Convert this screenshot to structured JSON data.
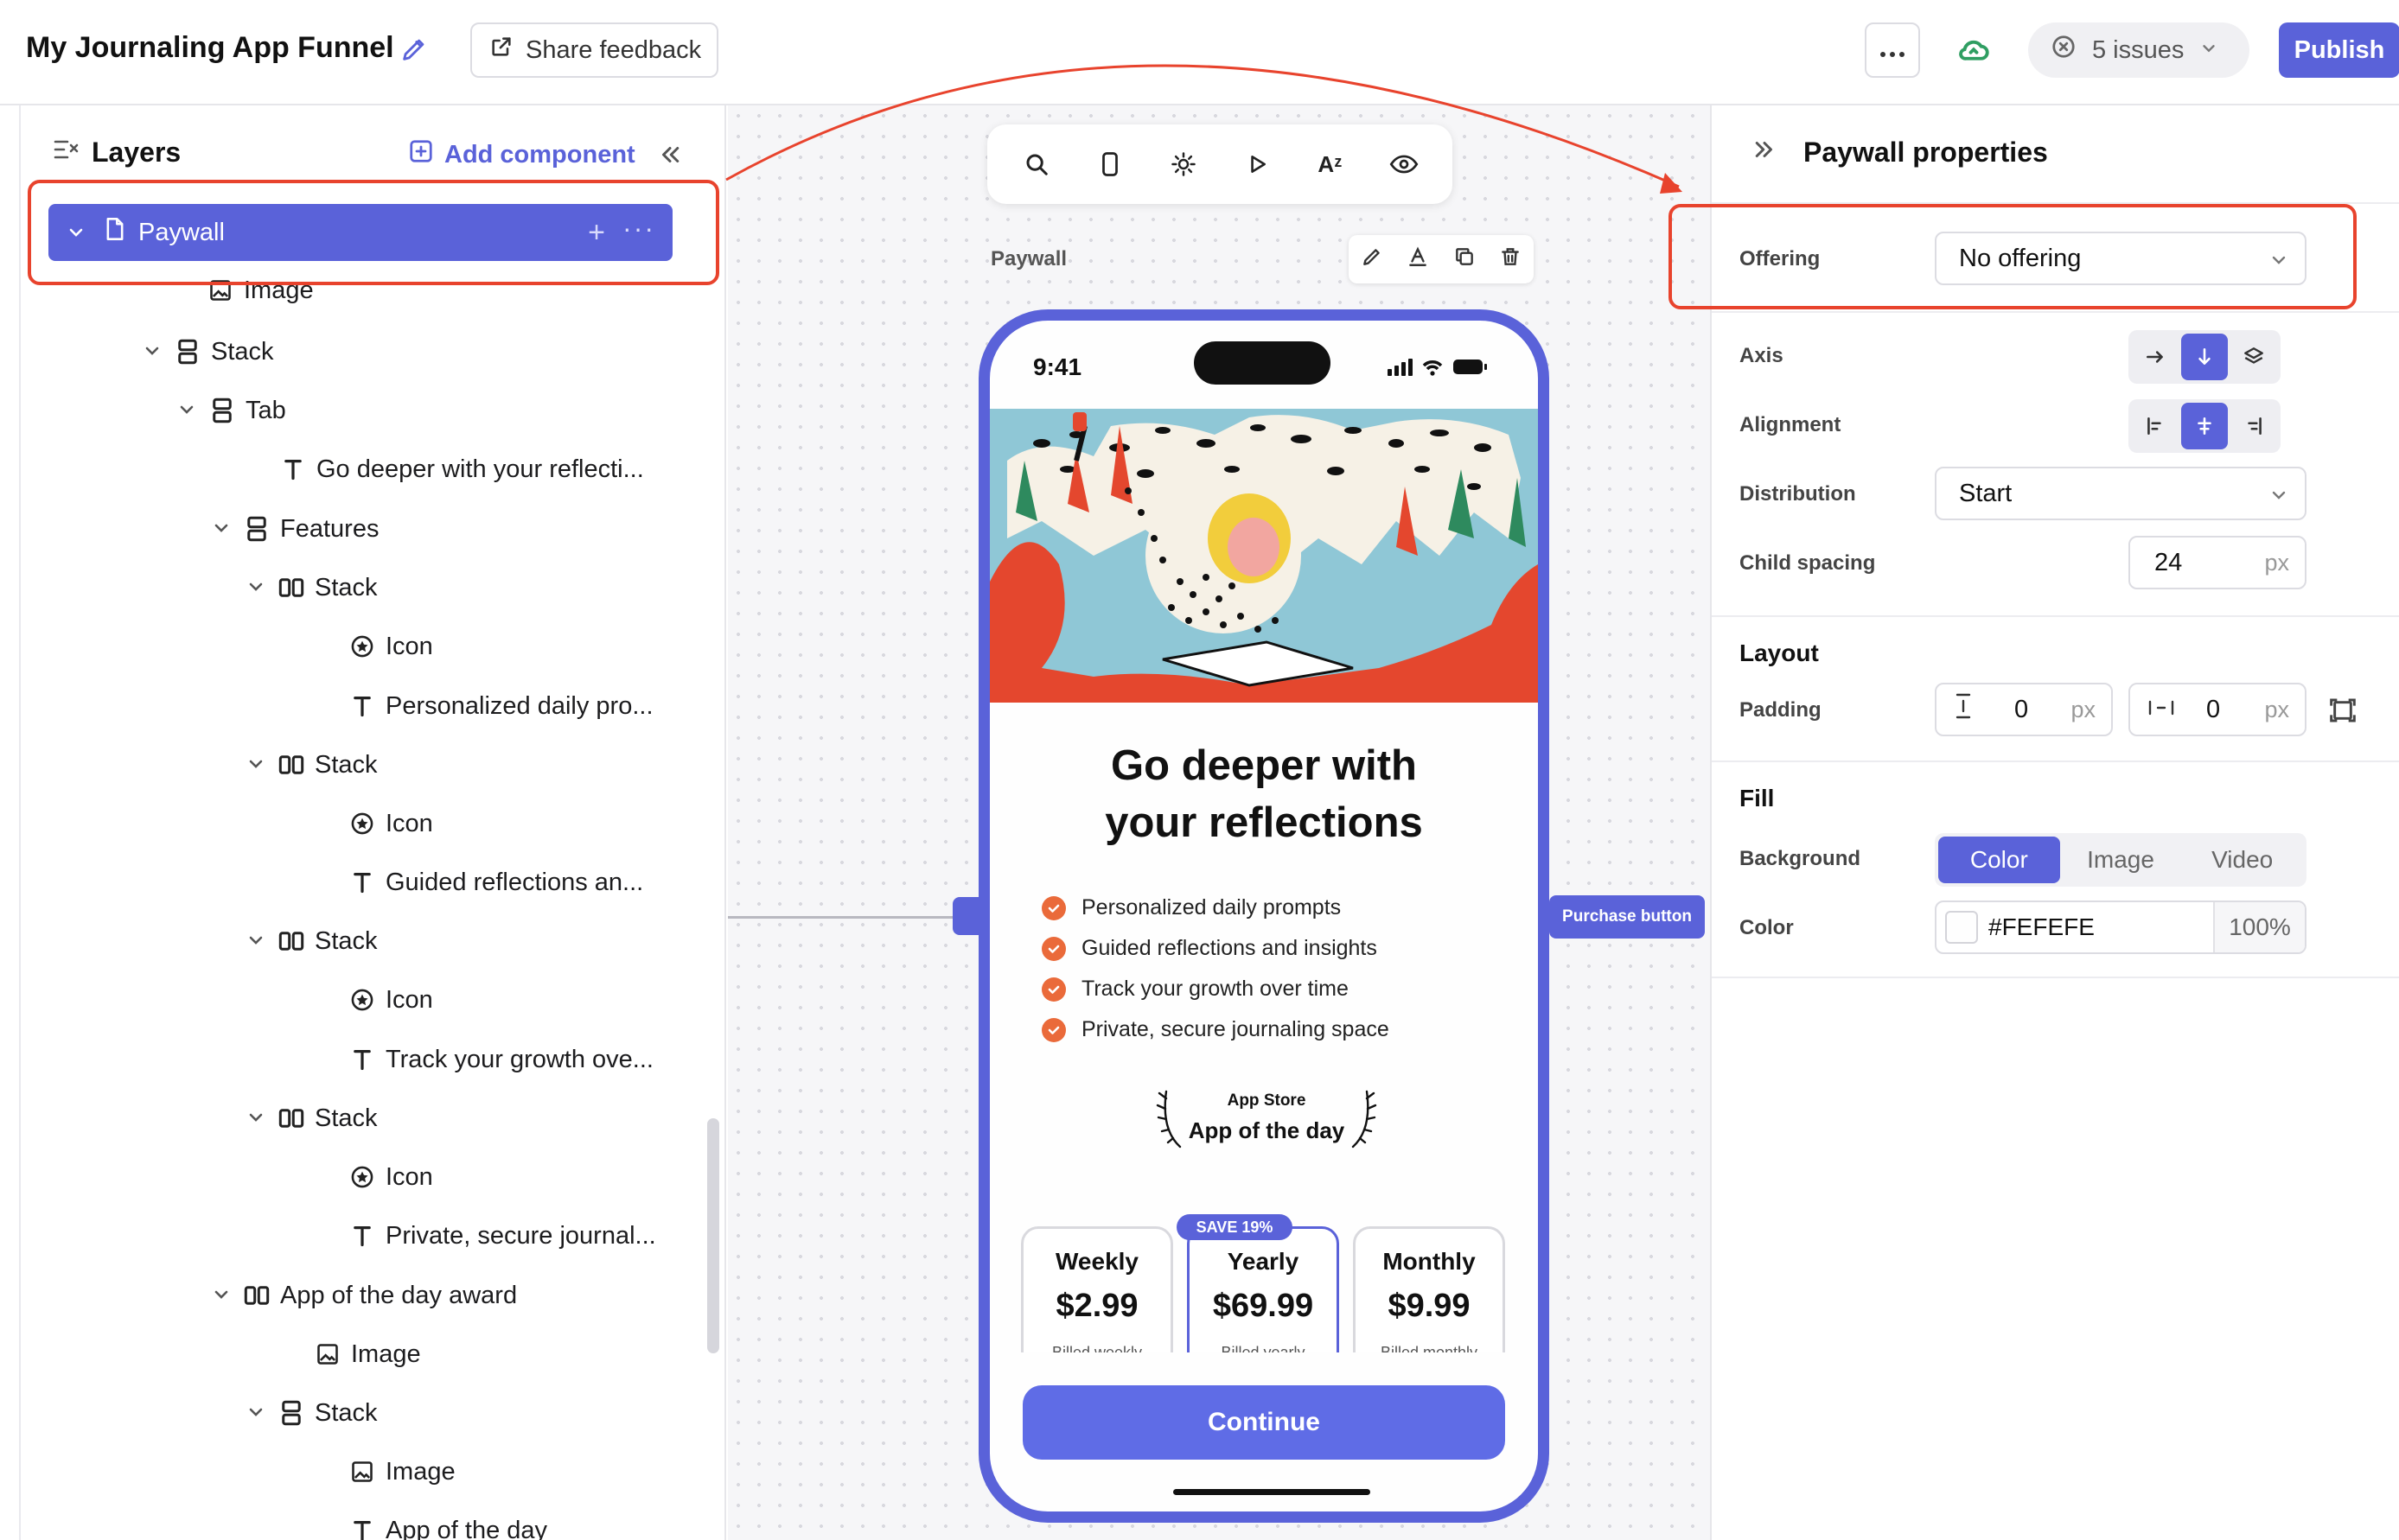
{
  "header": {
    "app_title": "My Journaling App Funnel",
    "share_label": "Share feedback",
    "issues_label": "5 issues",
    "publish_label": "Publish"
  },
  "layers": {
    "title": "Layers",
    "add_component": "Add component",
    "selected": "Paywall",
    "rows": [
      {
        "label": "Image",
        "icon": "image-icon"
      },
      {
        "label": "Stack",
        "icon": "vstack-icon"
      },
      {
        "label": "Tab",
        "icon": "vstack-icon"
      },
      {
        "label": "Go deeper with your reflecti...",
        "icon": "text-icon"
      },
      {
        "label": "Features",
        "icon": "vstack-icon"
      },
      {
        "label": "Stack",
        "icon": "hstack-icon"
      },
      {
        "label": "Icon",
        "icon": "star-icon"
      },
      {
        "label": "Personalized daily pro...",
        "icon": "text-icon"
      },
      {
        "label": "Stack",
        "icon": "hstack-icon"
      },
      {
        "label": "Icon",
        "icon": "star-icon"
      },
      {
        "label": "Guided reflections an...",
        "icon": "text-icon"
      },
      {
        "label": "Stack",
        "icon": "hstack-icon"
      },
      {
        "label": "Icon",
        "icon": "star-icon"
      },
      {
        "label": "Track your growth ove...",
        "icon": "text-icon"
      },
      {
        "label": "Stack",
        "icon": "hstack-icon"
      },
      {
        "label": "Icon",
        "icon": "star-icon"
      },
      {
        "label": "Private, secure journal...",
        "icon": "text-icon"
      },
      {
        "label": "App of the day award",
        "icon": "hstack-icon"
      },
      {
        "label": "Image",
        "icon": "image-icon"
      },
      {
        "label": "Stack",
        "icon": "vstack-icon"
      },
      {
        "label": "Image",
        "icon": "image-icon"
      },
      {
        "label": "App of the day",
        "icon": "text-icon"
      }
    ]
  },
  "canvas": {
    "frame_label": "Paywall",
    "purchase_tag": "Purchase button",
    "toolbar_font_glyph": "Aᶻ"
  },
  "phone": {
    "time": "9:41",
    "headline_line1": "Go deeper with",
    "headline_line2": "your reflections",
    "features": [
      "Personalized daily prompts",
      "Guided reflections and insights",
      "Track your growth over time",
      "Private, secure journaling space"
    ],
    "award_store": "App Store",
    "award_label": "App of the day",
    "save_badge": "SAVE 19%",
    "plans": [
      {
        "name": "Weekly",
        "price": "$2.99",
        "billed": "Billed weekly"
      },
      {
        "name": "Yearly",
        "price": "$69.99",
        "billed": "Billed yearly"
      },
      {
        "name": "Monthly",
        "price": "$9.99",
        "billed": "Billed monthly"
      }
    ],
    "continue_label": "Continue"
  },
  "properties": {
    "title": "Paywall properties",
    "offering_label": "Offering",
    "offering_value": "No offering",
    "axis_label": "Axis",
    "alignment_label": "Alignment",
    "distribution_label": "Distribution",
    "distribution_value": "Start",
    "child_spacing_label": "Child spacing",
    "child_spacing_value": "24",
    "unit_px": "px",
    "layout_title": "Layout",
    "padding_label": "Padding",
    "padding_vertical": "0",
    "padding_horizontal": "0",
    "fill_title": "Fill",
    "background_label": "Background",
    "background_tabs": [
      "Color",
      "Image",
      "Video"
    ],
    "color_label": "Color",
    "color_hex": "#FEFEFE",
    "color_opacity": "100%"
  },
  "colors": {
    "accent": "#5a62d9",
    "annotation_red": "#e8432d",
    "check_orange": "#ea6a3a"
  }
}
